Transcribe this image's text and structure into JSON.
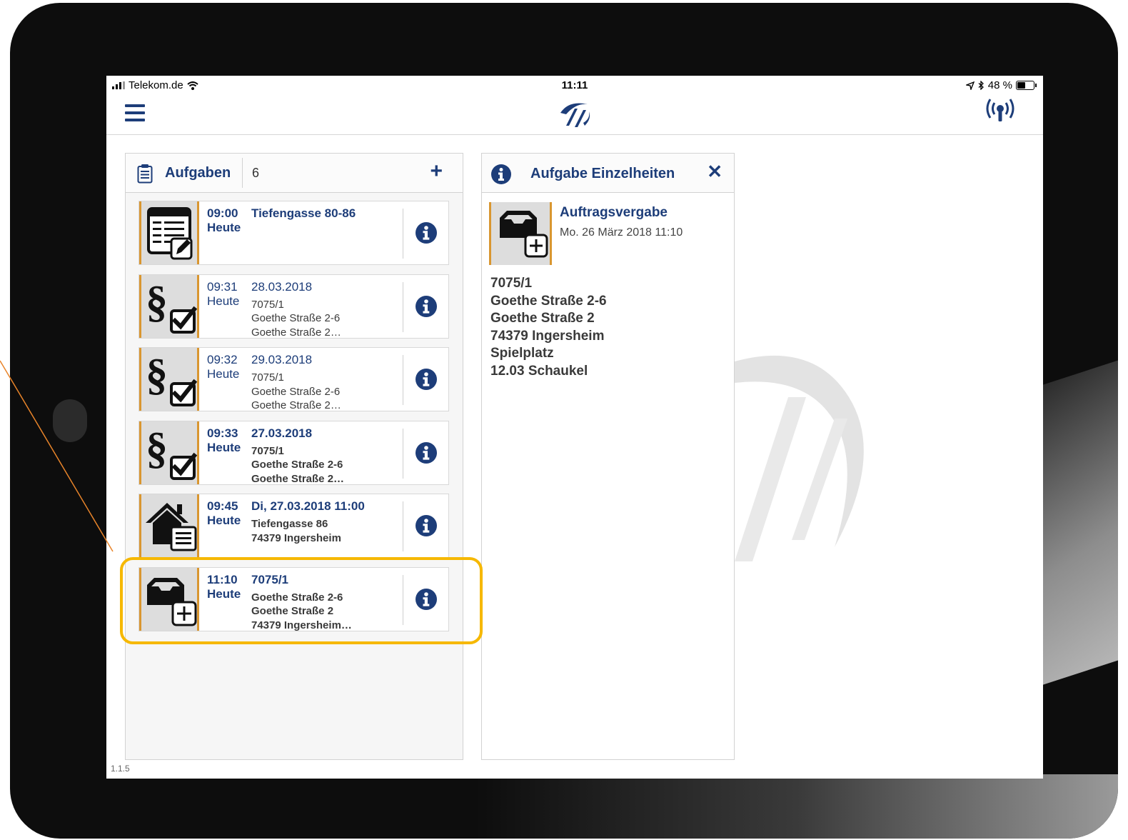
{
  "status_bar": {
    "carrier": "Telekom.de",
    "time": "11:11",
    "battery": "48 %",
    "icons": [
      "signal-icon",
      "wifi-icon",
      "location-arrow-icon",
      "bluetooth-icon",
      "battery-icon"
    ]
  },
  "nav": {
    "menu_icon": "hamburger-icon",
    "logo_icon": "app-logo-icon",
    "connection_icon": "connection-status-icon"
  },
  "tasks_panel": {
    "title": "Aufgaben",
    "count": "6",
    "add_label": "+",
    "items": [
      {
        "icon": "form-edit-icon",
        "time": "09:00",
        "day": "Heute",
        "title": "Tiefengasse 80-86",
        "lines": [],
        "bold": true
      },
      {
        "icon": "paragraph-check-icon",
        "time": "09:31",
        "day": "Heute",
        "title": "28.03.2018",
        "lines": [
          "7075/1",
          "Goethe Straße 2-6",
          "Goethe Straße 2…"
        ],
        "bold": false
      },
      {
        "icon": "paragraph-check-icon",
        "time": "09:32",
        "day": "Heute",
        "title": "29.03.2018",
        "lines": [
          "7075/1",
          "Goethe Straße 2-6",
          "Goethe Straße 2…"
        ],
        "bold": false
      },
      {
        "icon": "paragraph-check-icon",
        "time": "09:33",
        "day": "Heute",
        "title": "27.03.2018",
        "lines": [
          "7075/1",
          "Goethe Straße 2-6",
          "Goethe Straße 2…"
        ],
        "bold": true
      },
      {
        "icon": "house-list-icon",
        "time": "09:45",
        "day": "Heute",
        "title": "Di, 27.03.2018 11:00",
        "lines": [
          "Tiefengasse 86",
          "74379 Ingersheim"
        ],
        "bold": true
      },
      {
        "icon": "inbox-add-icon",
        "time": "11:10",
        "day": "Heute",
        "title": "7075/1",
        "lines": [
          "Goethe Straße 2-6",
          "Goethe Straße 2",
          "74379 Ingersheim…"
        ],
        "bold": true
      }
    ]
  },
  "details_panel": {
    "title": "Aufgabe Einzelheiten",
    "close_label": "✕",
    "name": "Auftragsvergabe",
    "date": "Mo. 26 März 2018 11:10",
    "lines": [
      "7075/1",
      "Goethe Straße 2-6",
      "Goethe Straße 2",
      "74379 Ingersheim",
      "Spielplatz",
      "12.03 Schaukel"
    ]
  },
  "version": "1.1.5",
  "colors": {
    "brand_blue": "#1d3d79",
    "thumb_accent": "#d99630",
    "highlight": "#f6b800",
    "callout": "#e8842a"
  }
}
